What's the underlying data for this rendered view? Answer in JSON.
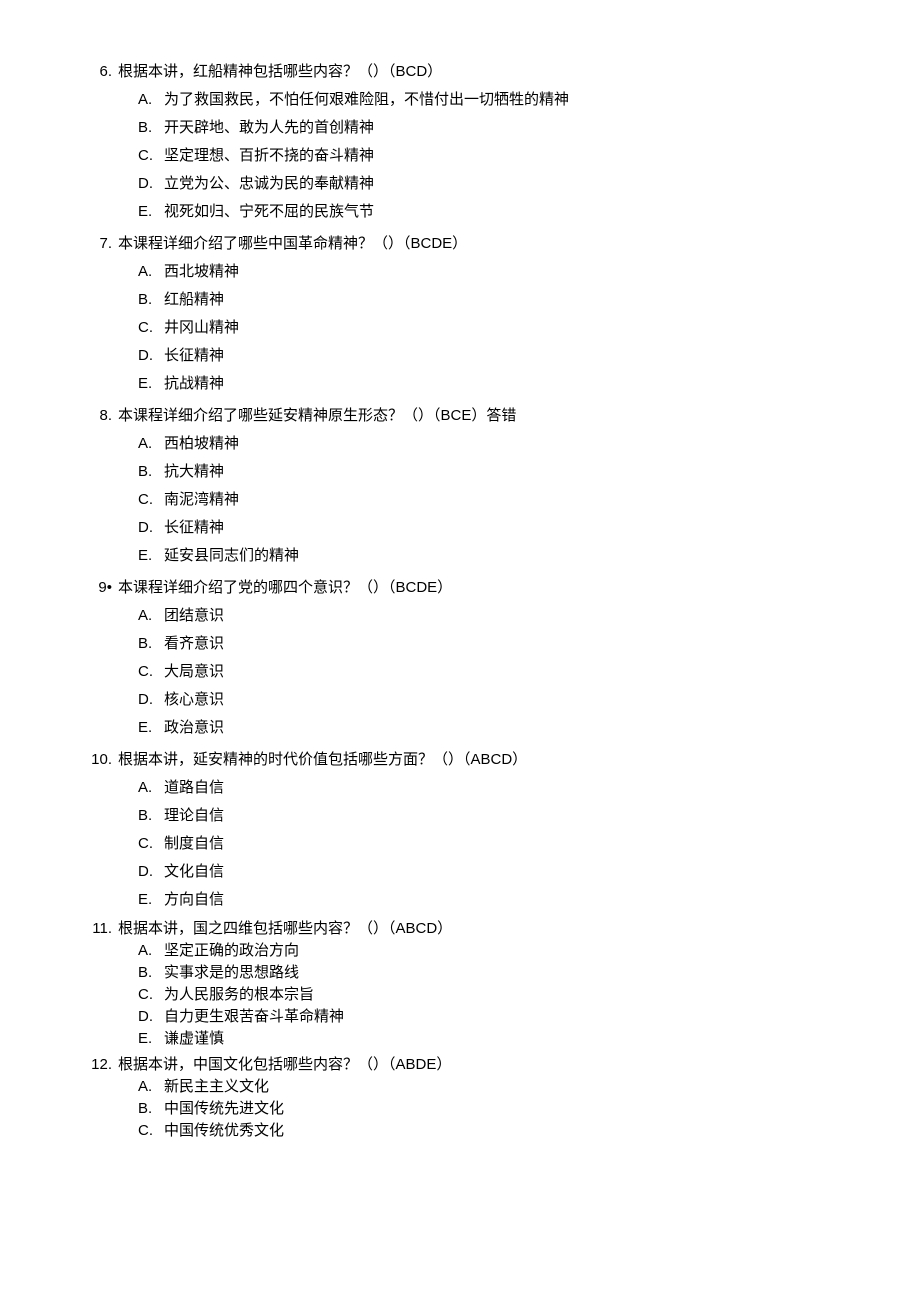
{
  "questions": [
    {
      "num": "6.",
      "text": "根据本讲，红船精神包括哪些内容？（）（BCD）",
      "tight": false,
      "options": [
        {
          "letter": "A.",
          "text": "为了救国救民，不怕任何艰难险阻，不惜付出一切牺牲的精神"
        },
        {
          "letter": "B.",
          "text": "开天辟地、敢为人先的首创精神"
        },
        {
          "letter": "C.",
          "text": "坚定理想、百折不挠的奋斗精神"
        },
        {
          "letter": "D.",
          "text": "立党为公、忠诚为民的奉献精神"
        },
        {
          "letter": "E.",
          "text": "视死如归、宁死不屈的民族气节"
        }
      ]
    },
    {
      "num": "7.",
      "text": "本课程详细介绍了哪些中国革命精神？（）（BCDE）",
      "tight": false,
      "options": [
        {
          "letter": "A.",
          "text": "西北坡精神"
        },
        {
          "letter": "B.",
          "text": "红船精神"
        },
        {
          "letter": "C.",
          "text": "井冈山精神"
        },
        {
          "letter": "D.",
          "text": "长征精神"
        },
        {
          "letter": "E.",
          "text": "抗战精神"
        }
      ]
    },
    {
      "num": "8.",
      "text": "本课程详细介绍了哪些延安精神原生形态？（）（BCE）答错",
      "tight": false,
      "options": [
        {
          "letter": "A.",
          "text": "西柏坡精神"
        },
        {
          "letter": "B.",
          "text": "抗大精神"
        },
        {
          "letter": "C.",
          "text": "南泥湾精神"
        },
        {
          "letter": "D.",
          "text": "长征精神"
        },
        {
          "letter": "E.",
          "text": "延安县同志们的精神"
        }
      ]
    },
    {
      "num": "9•",
      "text": "本课程详细介绍了党的哪四个意识？（）（BCDE）",
      "tight": false,
      "options": [
        {
          "letter": "A.",
          "text": "团结意识"
        },
        {
          "letter": "B.",
          "text": "看齐意识"
        },
        {
          "letter": "C.",
          "text": "大局意识"
        },
        {
          "letter": "D.",
          "text": "核心意识"
        },
        {
          "letter": "E.",
          "text": "政治意识"
        }
      ]
    },
    {
      "num": "10.",
      "text": "根据本讲，延安精神的时代价值包括哪些方面？（）（ABCD）",
      "tight": false,
      "options": [
        {
          "letter": "A.",
          "text": "道路自信"
        },
        {
          "letter": "B.",
          "text": "理论自信"
        },
        {
          "letter": "C.",
          "text": "制度自信"
        },
        {
          "letter": "D.",
          "text": "文化自信"
        },
        {
          "letter": "E.",
          "text": "方向自信"
        }
      ]
    },
    {
      "num": "11.",
      "text": "根据本讲，国之四维包括哪些内容？（）（ABCD）",
      "tight": true,
      "options": [
        {
          "letter": "A.",
          "text": "坚定正确的政治方向"
        },
        {
          "letter": "B.",
          "text": "实事求是的思想路线"
        },
        {
          "letter": "C.",
          "text": "为人民服务的根本宗旨"
        },
        {
          "letter": "D.",
          "text": "自力更生艰苦奋斗革命精神"
        },
        {
          "letter": "E.",
          "text": "谦虚谨慎"
        }
      ]
    },
    {
      "num": "12.",
      "text": "根据本讲，中国文化包括哪些内容？（）（ABDE）",
      "tight": true,
      "options": [
        {
          "letter": "A.",
          "text": "新民主主义文化"
        },
        {
          "letter": "B.",
          "text": "中国传统先进文化"
        },
        {
          "letter": "C.",
          "text": "中国传统优秀文化"
        }
      ]
    }
  ]
}
